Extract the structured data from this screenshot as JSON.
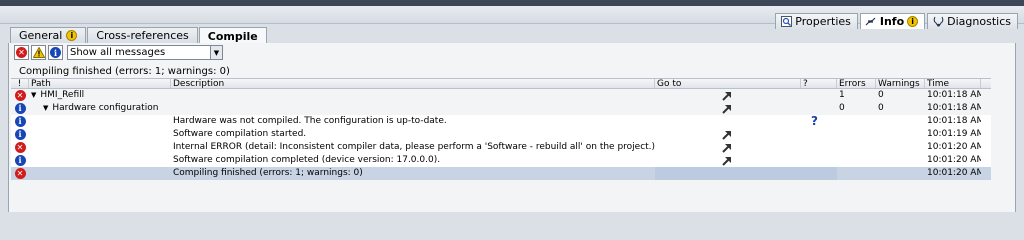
{
  "right_tabs": [
    {
      "label": "Properties",
      "icon": "properties-icon",
      "active": false
    },
    {
      "label": "Info",
      "icon": "info-icon",
      "badge": "i",
      "active": true
    },
    {
      "label": "Diagnostics",
      "icon": "diagnostics-icon",
      "active": false
    }
  ],
  "left_tabs": [
    {
      "label": "General",
      "badge": "i"
    },
    {
      "label": "Cross-references"
    },
    {
      "label": "Compile"
    }
  ],
  "filter": {
    "selected": "Show all messages"
  },
  "summary": "Compiling finished (errors: 1; warnings: 0)",
  "columns": {
    "status": "!",
    "path": "Path",
    "description": "Description",
    "goto": "Go to",
    "q": "?",
    "errors": "Errors",
    "warnings": "Warnings",
    "time": "Time"
  },
  "rows": [
    {
      "status": "error",
      "path": "HMI_Refill",
      "level": 0,
      "desc": "",
      "goto": true,
      "q": false,
      "errors": "1",
      "warnings": "0",
      "time": "10:01:18 AM"
    },
    {
      "status": "info",
      "path": "Hardware configuration",
      "level": 1,
      "desc": "",
      "goto": true,
      "q": false,
      "errors": "0",
      "warnings": "0",
      "time": "10:01:18 AM"
    },
    {
      "status": "info",
      "path": "",
      "level": 2,
      "desc": "Hardware was not compiled. The configuration is up-to-date.",
      "goto": false,
      "q": true,
      "errors": "",
      "warnings": "",
      "time": "10:01:18 AM"
    },
    {
      "status": "info",
      "path": "",
      "level": 2,
      "desc": "Software compilation started.",
      "goto": true,
      "q": false,
      "errors": "",
      "warnings": "",
      "time": "10:01:19 AM"
    },
    {
      "status": "error",
      "path": "",
      "level": 2,
      "desc": "Internal ERROR (detail: Inconsistent compiler data, please perform a 'Software - rebuild all' on the project.).",
      "goto": true,
      "q": false,
      "errors": "",
      "warnings": "",
      "time": "10:01:20 AM"
    },
    {
      "status": "info",
      "path": "",
      "level": 2,
      "desc": "Software compilation completed (device version: 17.0.0.0).",
      "goto": true,
      "q": false,
      "errors": "",
      "warnings": "",
      "time": "10:01:20 AM"
    },
    {
      "status": "error",
      "path": "",
      "level": 2,
      "desc": "Compiling finished (errors: 1; warnings: 0)",
      "goto": false,
      "q": false,
      "errors": "",
      "warnings": "",
      "time": "10:01:20 AM",
      "selected": true
    }
  ],
  "colors": {
    "error": "#d21b1b",
    "info": "#1746b6",
    "selection": "#c8d3e4"
  }
}
